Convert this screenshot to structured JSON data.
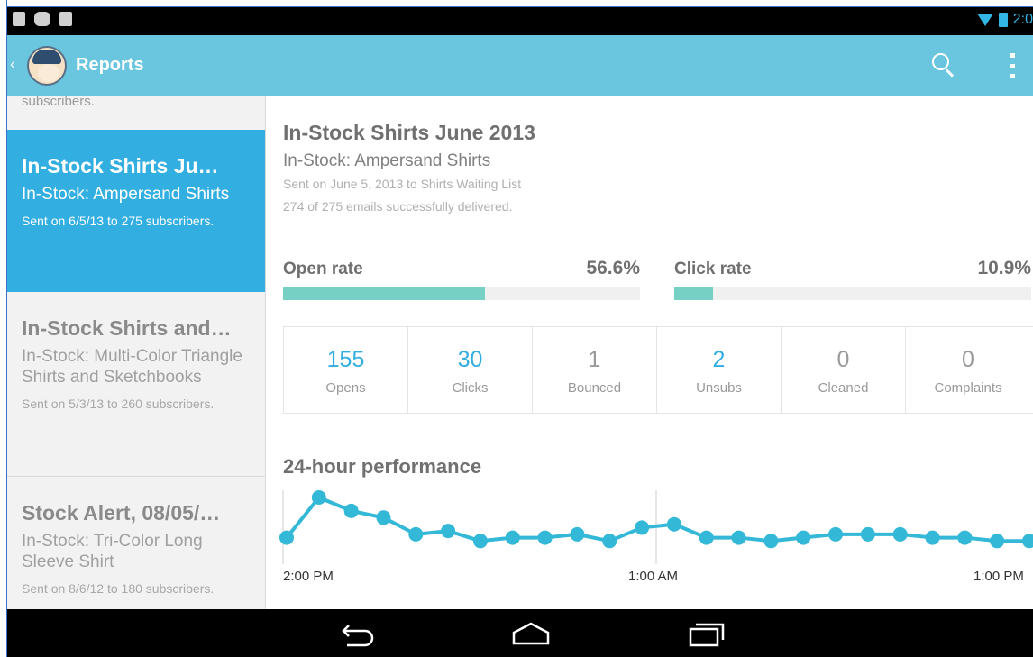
{
  "status_bar": {
    "time": "2:0",
    "left_icons": [
      "download-icon",
      "android-cat-icon",
      "play-store-icon"
    ],
    "right_icons": [
      "wifi-icon",
      "battery-icon"
    ]
  },
  "action_bar": {
    "title": "Reports",
    "back_glyph": "‹",
    "icons": [
      "mailchimp-logo",
      "search-icon",
      "overflow-menu-icon"
    ],
    "color": "#6ac5de"
  },
  "sidebar": {
    "top_fragment": "subscribers.",
    "items": [
      {
        "title": "In-Stock Shirts Ju…",
        "subtitle": "In-Stock: Ampersand Shirts",
        "meta": "Sent on 6/5/13 to 275 subscribers.",
        "active": true
      },
      {
        "title": "In-Stock Shirts and…",
        "subtitle": "In-Stock: Multi-Color Triangle Shirts and Sketchbooks",
        "meta": "Sent on 5/3/13 to 260 subscribers.",
        "active": false
      },
      {
        "title": "Stock Alert, 08/05/…",
        "subtitle": "In-Stock: Tri-Color Long Sleeve Shirt",
        "meta": "Sent on 8/6/12 to 180 subscribers.",
        "active": false
      }
    ],
    "active_color": "#33aee0"
  },
  "report": {
    "title": "In-Stock Shirts June 2013",
    "subtitle": "In-Stock: Ampersand Shirts",
    "sent_line": "Sent on June 5, 2013 to Shirts Waiting List",
    "delivered_line": "274 of 275 emails successfully delivered.",
    "open_rate": {
      "label": "Open rate",
      "value": "56.6%",
      "fraction": 0.566
    },
    "click_rate": {
      "label": "Click rate",
      "value": "10.9%",
      "fraction": 0.109
    },
    "bar_color": "#76d0c3",
    "stats": [
      {
        "value": "155",
        "label": "Opens",
        "accent": true
      },
      {
        "value": "30",
        "label": "Clicks",
        "accent": true
      },
      {
        "value": "1",
        "label": "Bounced",
        "accent": false
      },
      {
        "value": "2",
        "label": "Unsubs",
        "accent": true
      },
      {
        "value": "0",
        "label": "Cleaned",
        "accent": false
      },
      {
        "value": "0",
        "label": "Complaints",
        "accent": false
      }
    ],
    "performance_title": "24-hour performance"
  },
  "chart_data": {
    "type": "line",
    "title": "24-hour performance",
    "x_ticks": [
      "2:00 PM",
      "1:00 AM",
      "1:00 PM"
    ],
    "series": [
      {
        "values": [
          2,
          14,
          10,
          8,
          3,
          4,
          1,
          2,
          2,
          3,
          1,
          5,
          6,
          2,
          2,
          1,
          2,
          3,
          3,
          3,
          2,
          2,
          1,
          1
        ]
      }
    ],
    "color": "#33b8d8",
    "grid": "single vertical divider at 1:00 AM"
  },
  "nav_bar": {
    "icons": [
      "back-nav-icon",
      "home-nav-icon",
      "recent-apps-icon"
    ]
  }
}
